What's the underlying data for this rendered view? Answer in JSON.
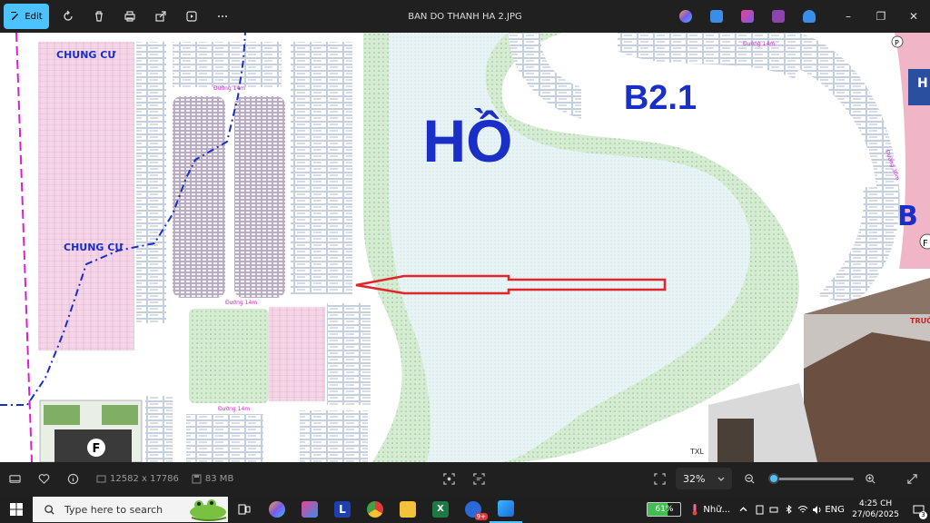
{
  "titlebar": {
    "edit_label": "Edit",
    "file_title": "BAN DO THANH HA 2.JPG",
    "minimize": "–",
    "maximize": "❐",
    "close": "✕"
  },
  "map": {
    "lake_label": "HỒ",
    "block_label": "B2.1",
    "chung_cu_top": "CHUNG CƯ",
    "chung_cu_mid": "CHUNG CƯ",
    "road_14m": "Đường 14m",
    "road_14m_b": "Đường 14m",
    "road_14m_c": "Đường 14m",
    "road_14m_d": "Đường 14m",
    "road_30m": "Đường 30m",
    "edge_b": "B",
    "edge_f": "F",
    "edge_p": "P",
    "facility_f": "F",
    "txl_label": "TXL",
    "truong_label": "TRƯỜ",
    "ha_label": "H"
  },
  "statusbar": {
    "dimensions": "12582 x 17786",
    "file_size": "83 MB",
    "zoom": "32%",
    "zoom_level": 0.06
  },
  "taskbar": {
    "search_placeholder": "Type here to search",
    "battery_percent": "61%",
    "battery_level": 0.61,
    "weather_text": "Nhữ...",
    "language": "ENG",
    "time": "4:25 CH",
    "date": "27/06/2025",
    "notif_count": "3",
    "badge": "9+"
  },
  "colors": {
    "accent": "#4cc2ff",
    "lake_fill": "#e7f3f4",
    "green_area": "#c6e7c0",
    "pink_area": "#f5d6e8",
    "label_blue": "#1a2ec8",
    "arrow_red": "#e0262b"
  }
}
